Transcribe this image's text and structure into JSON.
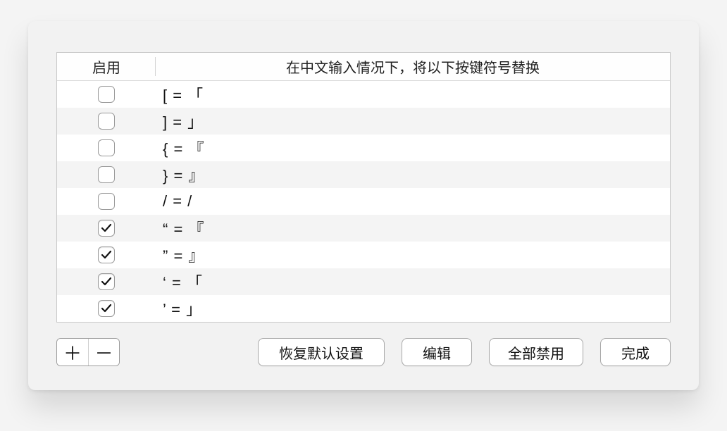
{
  "header": {
    "enable": "启用",
    "description": "在中文输入情况下，将以下按键符号替换"
  },
  "rows": [
    {
      "checked": false,
      "text": "[  =  「"
    },
    {
      "checked": false,
      "text": "]  =  」"
    },
    {
      "checked": false,
      "text": "{  =  『"
    },
    {
      "checked": false,
      "text": "}  =  』"
    },
    {
      "checked": false,
      "text": "/  =  /"
    },
    {
      "checked": true,
      "text": "“  =  『"
    },
    {
      "checked": true,
      "text": "”  =  』"
    },
    {
      "checked": true,
      "text": "‘  =  「"
    },
    {
      "checked": true,
      "text": "’  =  」"
    }
  ],
  "buttons": {
    "add": "＋",
    "remove": "－",
    "restore": "恢复默认设置",
    "edit": "编辑",
    "disable_all": "全部禁用",
    "done": "完成"
  }
}
